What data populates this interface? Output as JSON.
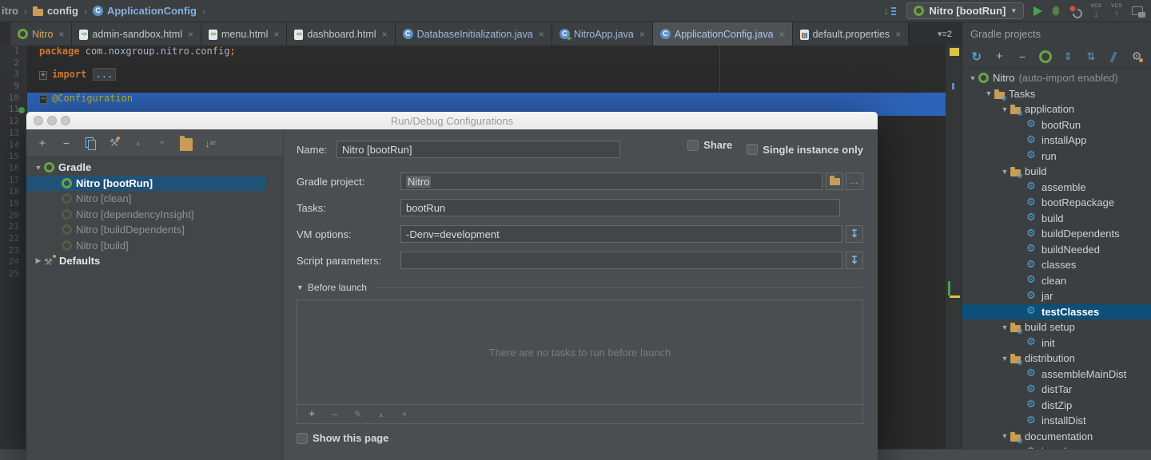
{
  "colors": {
    "selection_blue": "#2e63b8",
    "tree_selection_blue": "#205278",
    "panel_selection_blue": "#0d4f76",
    "gradle_green": "#6aa443",
    "task_blue": "#4ea0d6",
    "folder_amber": "#c79d58",
    "keyword_orange": "#cc7832",
    "annotation_yellow": "#bbb529"
  },
  "breadcrumb": {
    "items": [
      {
        "label": "itro",
        "icon": null
      },
      {
        "label": "config",
        "icon": "folder"
      },
      {
        "label": "ApplicationConfig",
        "icon": "class"
      }
    ]
  },
  "run_toolbar": {
    "config_label": "Nitro [bootRun]",
    "vcs_label": "VCS"
  },
  "tabs": [
    {
      "label": "Nitro",
      "icon": "gradle",
      "color": "gold"
    },
    {
      "label": "admin-sandbox.html",
      "icon": "html"
    },
    {
      "label": "menu.html",
      "icon": "html"
    },
    {
      "label": "dashboard.html",
      "icon": "html"
    },
    {
      "label": "DatabaseInitialization.java",
      "icon": "class",
      "color": "blue"
    },
    {
      "label": "NitroApp.java",
      "icon": "class-run",
      "color": "blue"
    },
    {
      "label": "ApplicationConfig.java",
      "icon": "class",
      "color": "blue",
      "active": true
    },
    {
      "label": "default.properties",
      "icon": "properties"
    }
  ],
  "tab_overflow": {
    "count": "2"
  },
  "editor": {
    "line_numbers": [
      "1",
      "2",
      "3",
      "9",
      "10",
      "11",
      "12",
      "13",
      "14",
      "15",
      "16",
      "17",
      "18",
      "19",
      "20",
      "21",
      "22",
      "23",
      "24",
      "25"
    ],
    "lines": [
      {
        "tokens": [
          {
            "t": "package ",
            "c": "kw"
          },
          {
            "t": "com.noxgroup.nitro.config",
            "c": "pl"
          },
          {
            "t": ";",
            "c": "kw"
          }
        ]
      },
      {
        "tokens": []
      },
      {
        "fold": "plus",
        "tokens": [
          {
            "t": "import ",
            "c": "kw"
          },
          {
            "t": "...",
            "c": "fold"
          }
        ]
      },
      {
        "tokens": []
      },
      {
        "fold": "minus",
        "hl": true,
        "tokens": [
          {
            "t": "@Configuration",
            "c": "ann"
          }
        ]
      },
      {
        "hl": true,
        "tokens": []
      },
      {
        "tokens": []
      },
      {
        "tokens": []
      },
      {
        "tokens": []
      },
      {
        "tokens": []
      },
      {
        "tokens": []
      },
      {
        "tokens": []
      },
      {
        "tokens": []
      },
      {
        "tokens": []
      },
      {
        "tokens": []
      },
      {
        "tokens": []
      },
      {
        "tokens": []
      },
      {
        "tokens": []
      },
      {
        "tokens": []
      },
      {
        "tokens": []
      }
    ]
  },
  "gradle_panel": {
    "title": "Gradle projects",
    "tree": [
      {
        "level": 0,
        "arrow": "down",
        "icon": "gradle",
        "label": "Nitro",
        "suffix": "(auto-import enabled)"
      },
      {
        "level": 1,
        "arrow": "down",
        "icon": "tasks-folder",
        "label": "Tasks"
      },
      {
        "level": 2,
        "arrow": "down",
        "icon": "tasks-folder",
        "label": "application"
      },
      {
        "level": 3,
        "icon": "task",
        "label": "bootRun"
      },
      {
        "level": 3,
        "icon": "task",
        "label": "installApp"
      },
      {
        "level": 3,
        "icon": "task",
        "label": "run"
      },
      {
        "level": 2,
        "arrow": "down",
        "icon": "tasks-folder",
        "label": "build"
      },
      {
        "level": 3,
        "icon": "task",
        "label": "assemble"
      },
      {
        "level": 3,
        "icon": "task",
        "label": "bootRepackage"
      },
      {
        "level": 3,
        "icon": "task",
        "label": "build"
      },
      {
        "level": 3,
        "icon": "task",
        "label": "buildDependents"
      },
      {
        "level": 3,
        "icon": "task",
        "label": "buildNeeded"
      },
      {
        "level": 3,
        "icon": "task",
        "label": "classes"
      },
      {
        "level": 3,
        "icon": "task",
        "label": "clean"
      },
      {
        "level": 3,
        "icon": "task",
        "label": "jar"
      },
      {
        "level": 3,
        "icon": "task",
        "label": "testClasses",
        "selected": true
      },
      {
        "level": 2,
        "arrow": "down",
        "icon": "tasks-folder",
        "label": "build setup"
      },
      {
        "level": 3,
        "icon": "task",
        "label": "init"
      },
      {
        "level": 2,
        "arrow": "down",
        "icon": "tasks-folder",
        "label": "distribution"
      },
      {
        "level": 3,
        "icon": "task",
        "label": "assembleMainDist"
      },
      {
        "level": 3,
        "icon": "task",
        "label": "distTar"
      },
      {
        "level": 3,
        "icon": "task",
        "label": "distZip"
      },
      {
        "level": 3,
        "icon": "task",
        "label": "installDist"
      },
      {
        "level": 2,
        "arrow": "down",
        "icon": "tasks-folder",
        "label": "documentation"
      },
      {
        "level": 3,
        "icon": "task",
        "label": "javadoc"
      }
    ]
  },
  "dialog": {
    "title": "Run/Debug Configurations",
    "tree": [
      {
        "level": 0,
        "arrow": "down",
        "icon": "gradle",
        "label": "Gradle",
        "bold": true
      },
      {
        "level": 1,
        "icon": "gradle",
        "label": "Nitro [bootRun]",
        "selected": true
      },
      {
        "level": 1,
        "icon": "gradle-dim",
        "label": "Nitro [clean]",
        "dim": true
      },
      {
        "level": 1,
        "icon": "gradle-dim",
        "label": "Nitro [dependencyInsight]",
        "dim": true
      },
      {
        "level": 1,
        "icon": "gradle-dim",
        "label": "Nitro [buildDependents]",
        "dim": true
      },
      {
        "level": 1,
        "icon": "gradle-dim",
        "label": "Nitro [build]",
        "dim": true
      },
      {
        "level": 0,
        "arrow": "right",
        "icon": "defaults",
        "label": "Defaults",
        "bold": true
      }
    ],
    "form": {
      "name_label": "Name:",
      "name_value": "Nitro [bootRun]",
      "share_label": "Share",
      "single_instance_label": "Single instance only",
      "gradle_project_label": "Gradle project:",
      "gradle_project_value": "Nitro",
      "tasks_label": "Tasks:",
      "tasks_value": "bootRun",
      "vm_options_label": "VM options:",
      "vm_options_value": "-Denv=development",
      "script_parameters_label": "Script parameters:",
      "script_parameters_value": ""
    },
    "before_launch": {
      "label": "Before launch",
      "empty_text": "There are no tasks to run before launch"
    },
    "show_this_page_label": "Show this page"
  }
}
